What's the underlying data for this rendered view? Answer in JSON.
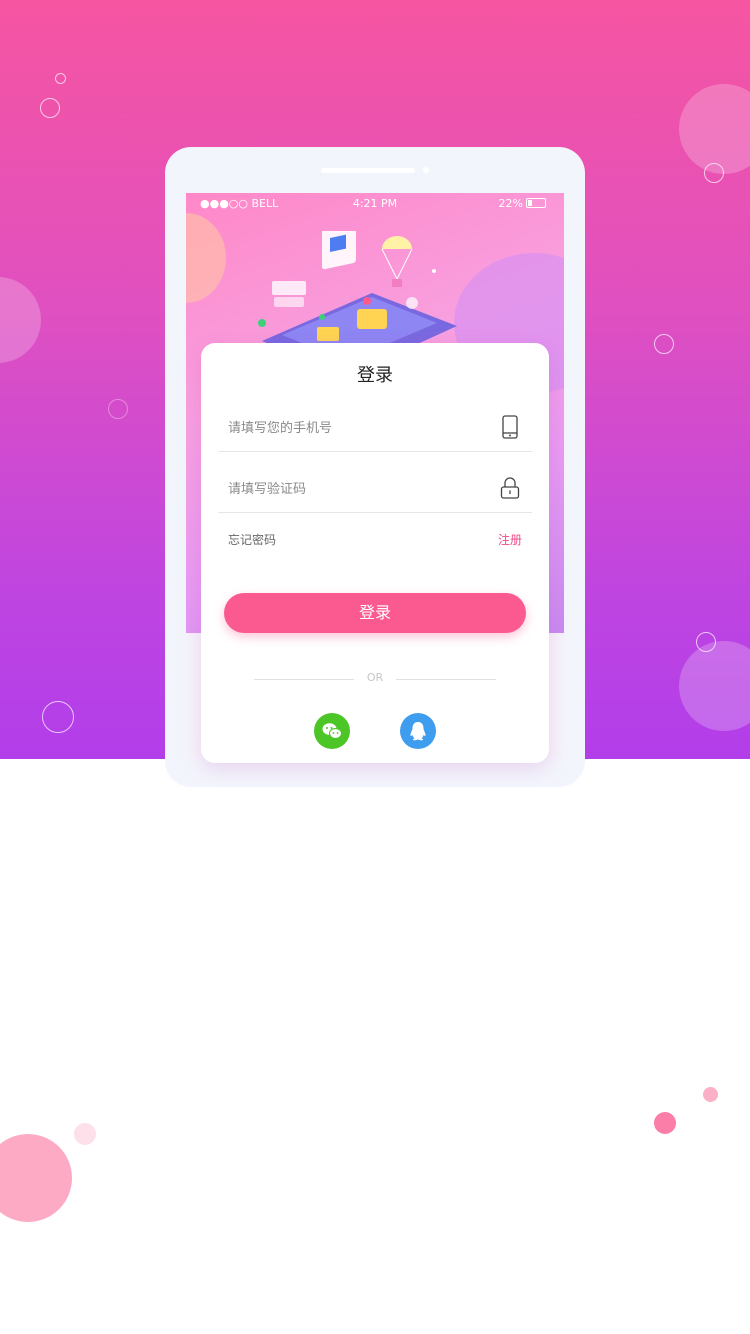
{
  "status_bar": {
    "carrier": "●●●○○ BELL",
    "time": "4:21 PM",
    "battery": "22%"
  },
  "login": {
    "title": "登录",
    "phone_placeholder": "请填写您的手机号",
    "code_placeholder": "请填写验证码",
    "forgot_password": "忘记密码",
    "register": "注册",
    "submit": "登录",
    "divider": "OR"
  },
  "icons": {
    "phone": "phone-icon",
    "lock": "lock-icon",
    "wechat": "wechat-icon",
    "qq": "qq-icon"
  },
  "colors": {
    "accent": "#fb5a91",
    "register_link": "#f04a8a",
    "wechat": "#4cc527",
    "qq": "#3f9df0",
    "gradient_top": "#f655a1",
    "gradient_bottom": "#b23eea"
  }
}
